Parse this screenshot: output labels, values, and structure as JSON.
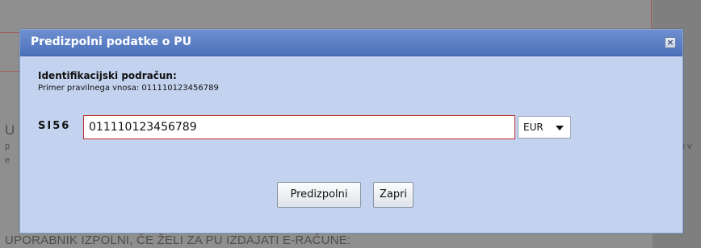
{
  "background": {
    "fragment_u": "U",
    "fragment_p": "p",
    "fragment_e": "e",
    "fragment_right": "u v",
    "bottom_text": "UPORABNIK IZPOLNI, ČE ŽELI ZA PU IZDAJATI E-RAČUNE:"
  },
  "dialog": {
    "title": "Predizpolni podatke o PU",
    "close_symbol": "×",
    "field_label": "Identifikacijski podračun:",
    "example_hint": "Primer pravilnega vnosa: 011110123456789",
    "iban_prefix": "SI56",
    "iban_value": "011110123456789",
    "currency_selected": "EUR",
    "buttons": {
      "prefill": "Predizpolni",
      "close": "Zapri"
    }
  },
  "colors": {
    "titlebar": "#4c71bb",
    "dialog_body": "#c3d2ee",
    "input_error_border": "#c0302e"
  }
}
